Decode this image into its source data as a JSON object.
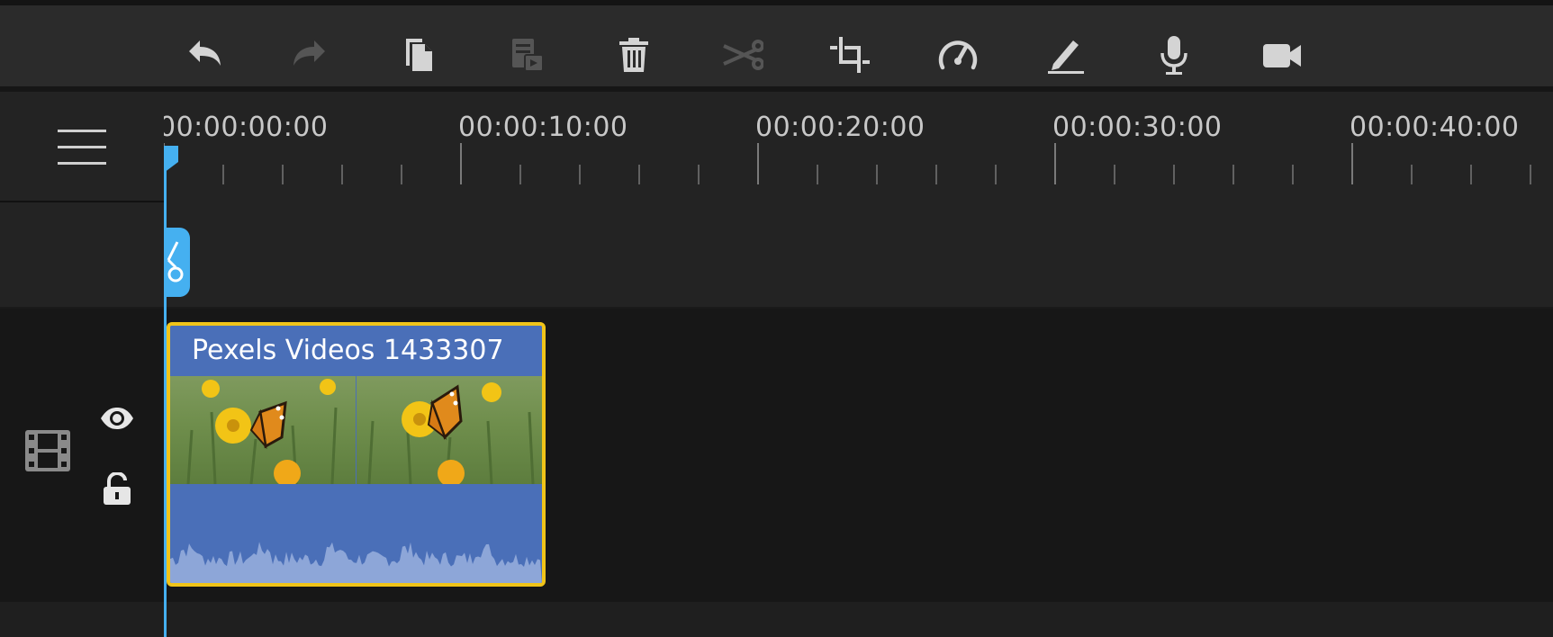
{
  "toolbar": {
    "buttons": [
      {
        "name": "undo-button",
        "icon": "undo-icon",
        "enabled": true
      },
      {
        "name": "redo-button",
        "icon": "redo-icon",
        "enabled": false
      },
      {
        "name": "copy-button",
        "icon": "copy-icon",
        "enabled": true
      },
      {
        "name": "paste-button",
        "icon": "paste-icon",
        "enabled": false
      },
      {
        "name": "delete-button",
        "icon": "trash-icon",
        "enabled": true
      },
      {
        "name": "split-button",
        "icon": "scissors-icon",
        "enabled": false
      },
      {
        "name": "crop-button",
        "icon": "crop-icon",
        "enabled": true
      },
      {
        "name": "speed-button",
        "icon": "speedometer-icon",
        "enabled": true
      },
      {
        "name": "edit-button",
        "icon": "pen-icon",
        "enabled": true
      },
      {
        "name": "record-voice-button",
        "icon": "microphone-icon",
        "enabled": true
      },
      {
        "name": "record-video-button",
        "icon": "video-camera-icon",
        "enabled": true
      }
    ]
  },
  "ruler": {
    "timecodes": [
      "00:00:00:00",
      "00:00:10:00",
      "00:00:20:00",
      "00:00:30:00",
      "00:00:40:00"
    ]
  },
  "track": {
    "type_icon": "film-strip-icon",
    "visibility_icon": "eye-icon",
    "lock_icon": "unlock-icon"
  },
  "clip": {
    "title": "Pexels Videos 1433307",
    "selected": true
  },
  "colors": {
    "accent": "#45b0f0",
    "clip_fill": "#4a6fb8",
    "clip_border": "#f0c419",
    "toolbar_bg": "#2b2b2b",
    "enabled_icon": "#d4d4d4",
    "disabled_icon": "#555555"
  }
}
